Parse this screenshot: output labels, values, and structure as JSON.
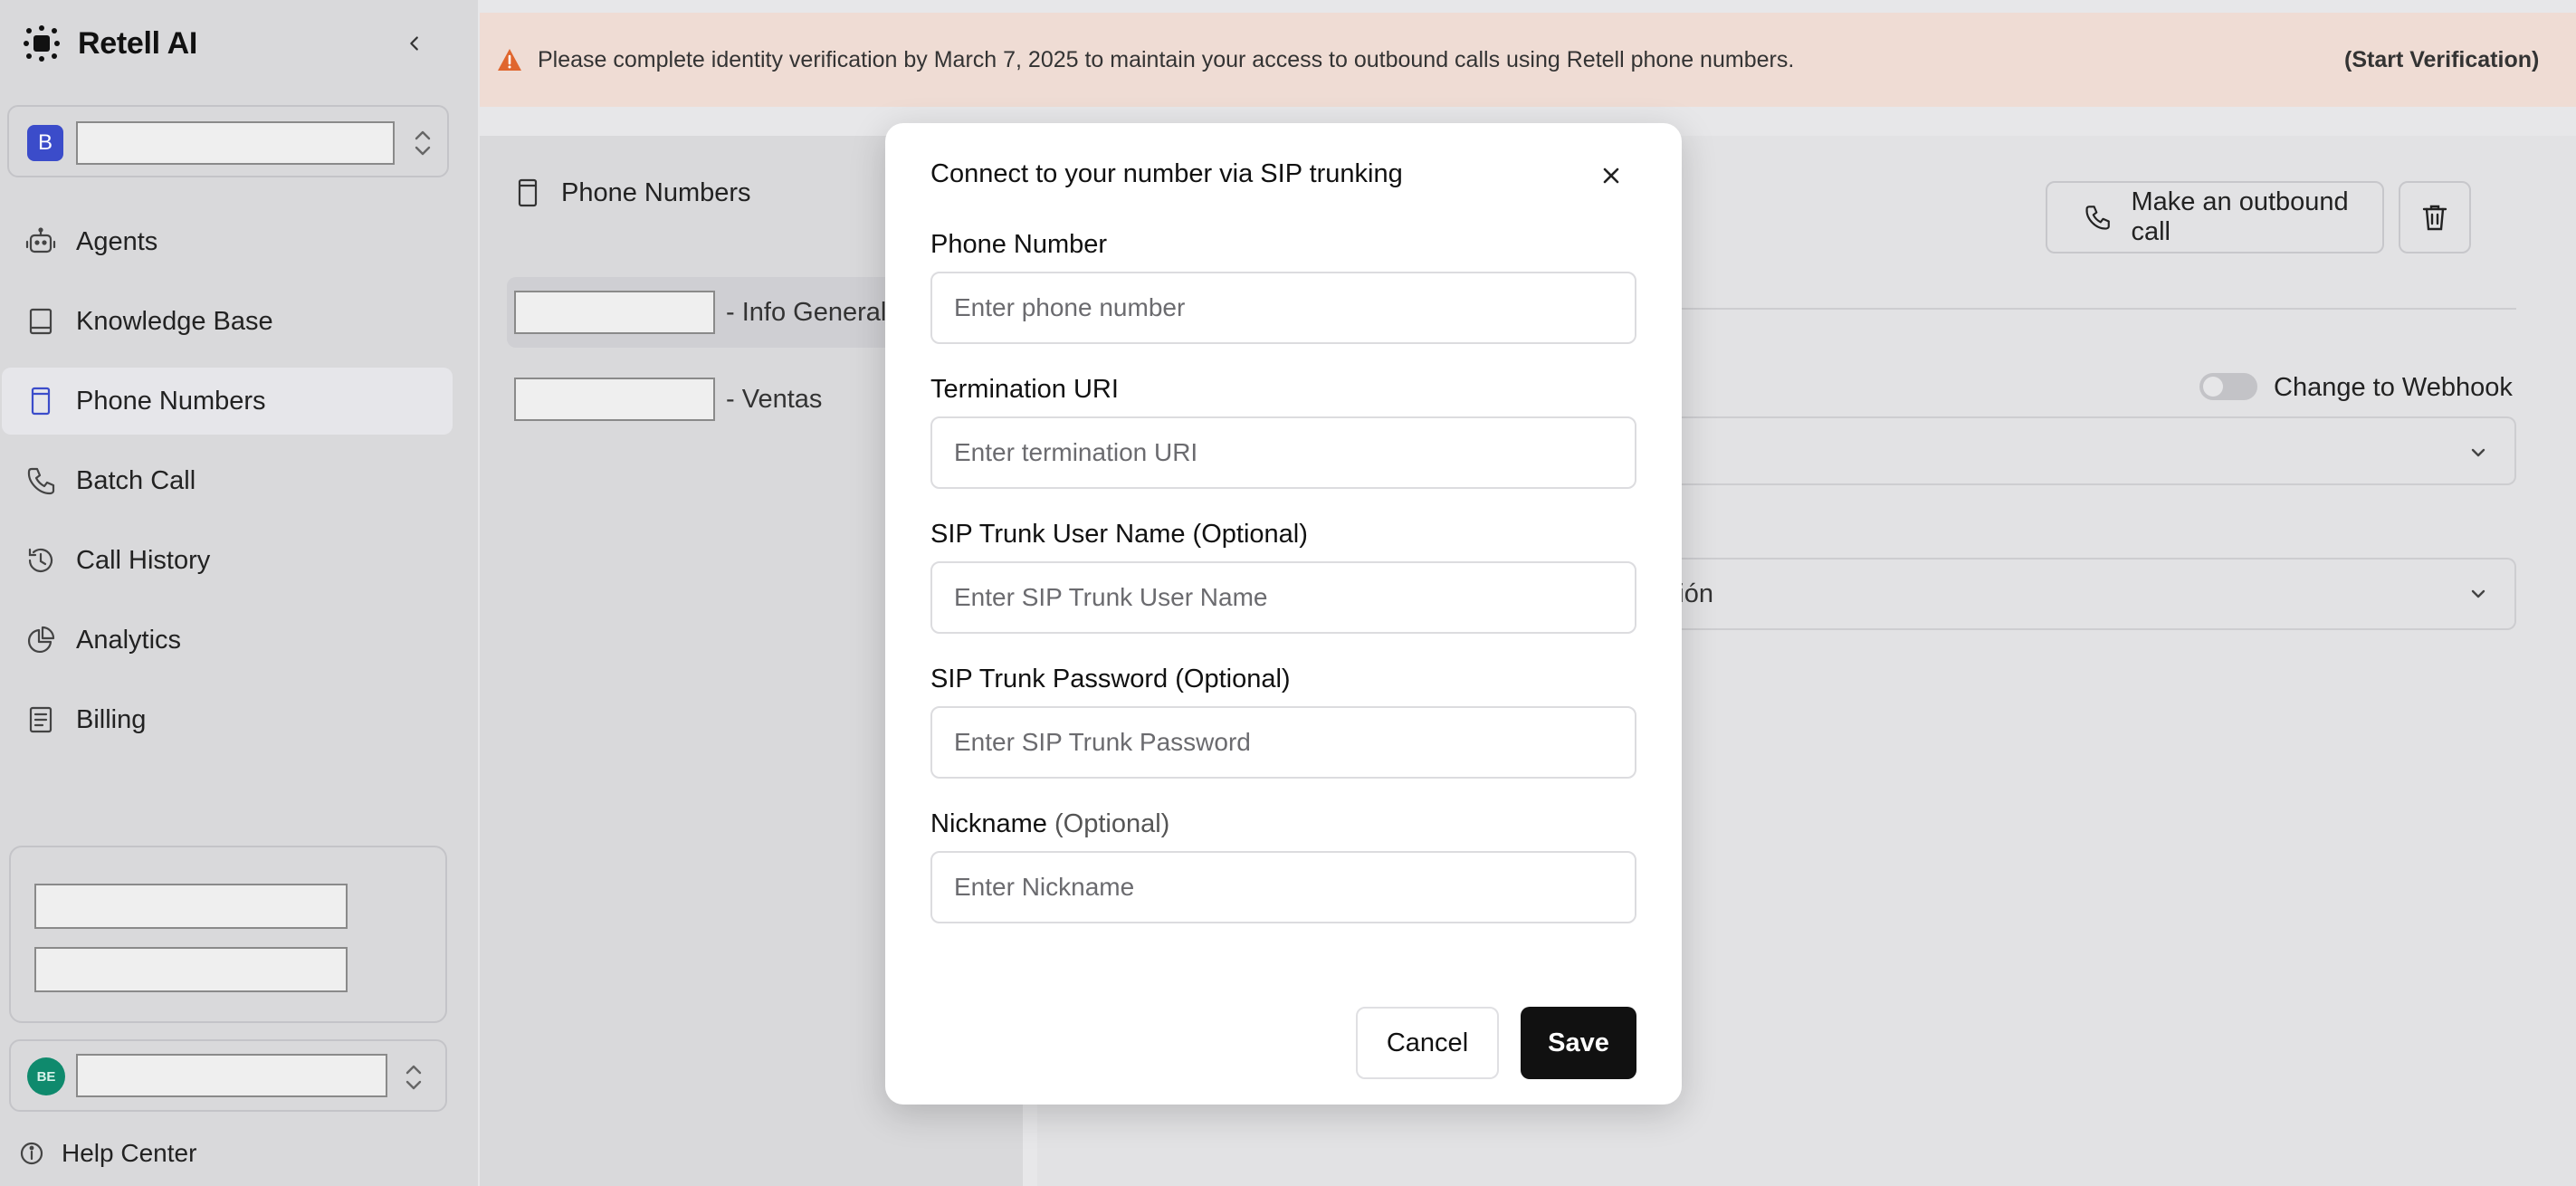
{
  "app": {
    "name": "Retell AI"
  },
  "workspace": {
    "badge": "B"
  },
  "sidebar": {
    "items": [
      {
        "label": "Agents",
        "icon": "robot-icon",
        "active": false
      },
      {
        "label": "Knowledge Base",
        "icon": "book-icon",
        "active": false
      },
      {
        "label": "Phone Numbers",
        "icon": "phone-card-icon",
        "active": true
      },
      {
        "label": "Batch Call",
        "icon": "phone-icon",
        "active": false
      },
      {
        "label": "Call History",
        "icon": "history-icon",
        "active": false
      },
      {
        "label": "Analytics",
        "icon": "pie-chart-icon",
        "active": false
      },
      {
        "label": "Billing",
        "icon": "receipt-icon",
        "active": false
      }
    ],
    "account_initials": "BE",
    "help_label": "Help Center"
  },
  "banner": {
    "text": "Please complete identity verification by March 7, 2025 to maintain your access to outbound calls using Retell phone numbers.",
    "link": "(Start Verification)",
    "color": "#efdcd4"
  },
  "phone_list": {
    "title": "Phone Numbers",
    "rows": [
      {
        "suffix": "- Info General",
        "selected": true
      },
      {
        "suffix": "- Ventas",
        "selected": false
      }
    ]
  },
  "detail": {
    "outbound_button": "Make an outbound call",
    "webhook_label": "Change to Webhook",
    "select2_text": "ración"
  },
  "modal": {
    "title": "Connect to your number via SIP trunking",
    "fields": [
      {
        "label": "Phone Number",
        "optional": "",
        "placeholder": "Enter phone number",
        "value": ""
      },
      {
        "label": "Termination URI",
        "optional": "",
        "placeholder": "Enter termination URI",
        "value": ""
      },
      {
        "label": "SIP Trunk User Name (Optional)",
        "optional": "",
        "placeholder": "Enter SIP Trunk User Name",
        "value": ""
      },
      {
        "label": "SIP Trunk Password (Optional)",
        "optional": "",
        "placeholder": "Enter SIP Trunk Password",
        "value": ""
      },
      {
        "label": "Nickname",
        "optional": "(Optional)",
        "placeholder": "Enter Nickname",
        "value": ""
      }
    ],
    "cancel_label": "Cancel",
    "save_label": "Save"
  }
}
